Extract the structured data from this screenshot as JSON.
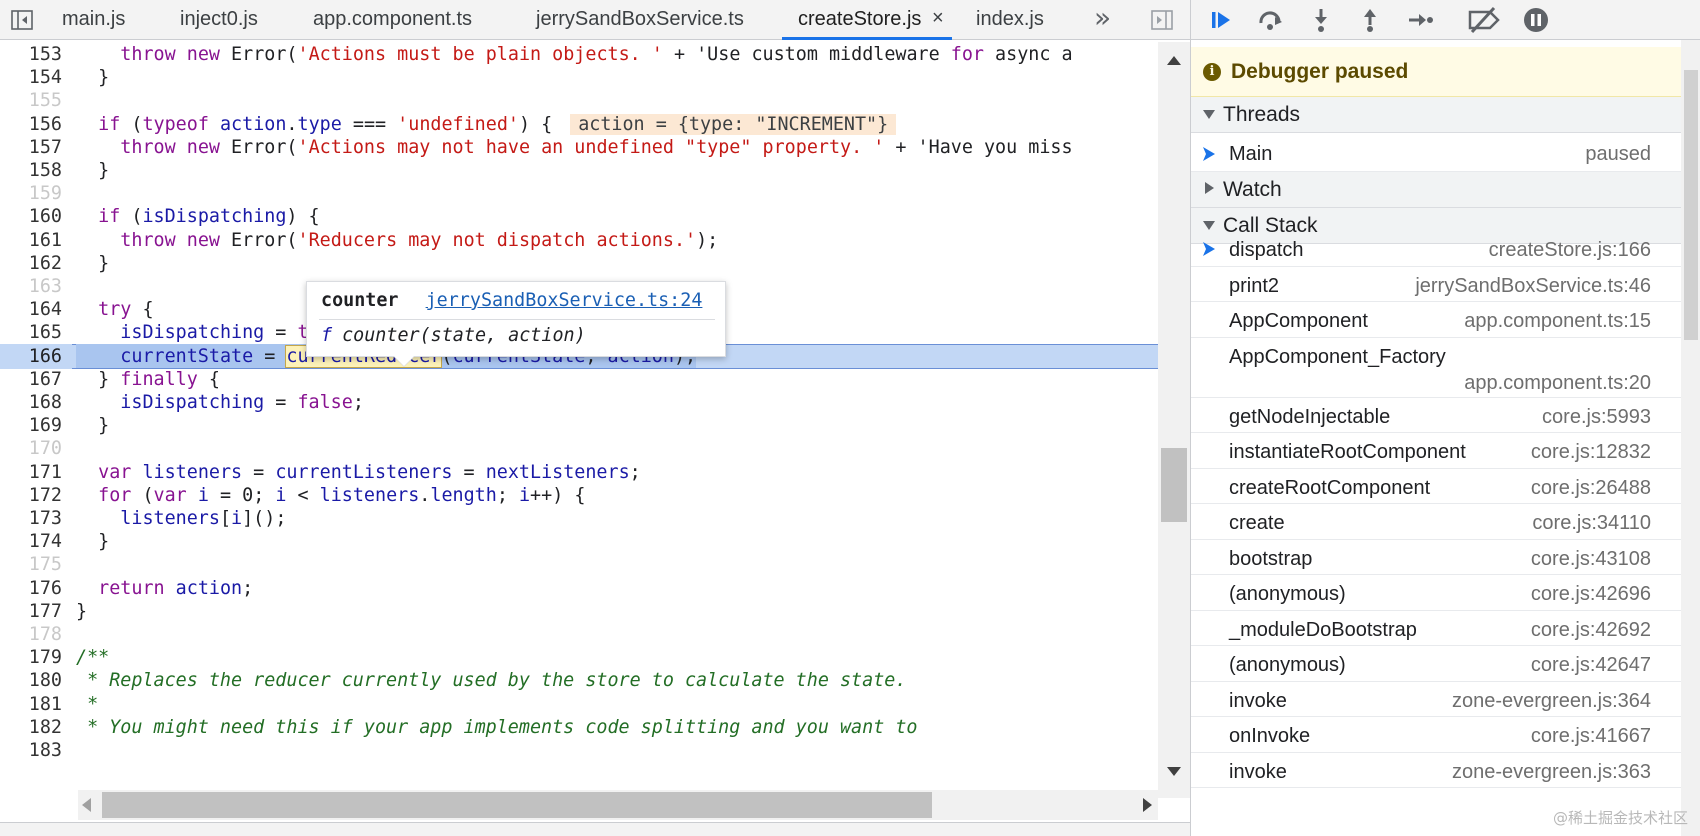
{
  "tabs": [
    {
      "label": "main.js"
    },
    {
      "label": "inject0.js"
    },
    {
      "label": "app.component.ts"
    },
    {
      "label": "jerrySandBoxService.ts"
    },
    {
      "label": "createStore.js",
      "active": true,
      "close": "×"
    },
    {
      "label": "index.js"
    }
  ],
  "tabs_more": "»",
  "code_lines": [
    {
      "n": "153",
      "text": "    throw new Error('Actions must be plain objects. ' + 'Use custom middleware for async a"
    },
    {
      "n": "154",
      "text": "  }"
    },
    {
      "n": "155",
      "text": ""
    },
    {
      "n": "156",
      "text": "  if (typeof action.type === 'undefined') {"
    },
    {
      "n": "157",
      "text": "    throw new Error('Actions may not have an undefined \"type\" property. ' + 'Have you miss"
    },
    {
      "n": "158",
      "text": "  }"
    },
    {
      "n": "159",
      "text": ""
    },
    {
      "n": "160",
      "text": "  if (isDispatching) {"
    },
    {
      "n": "161",
      "text": "    throw new Error('Reducers may not dispatch actions.');"
    },
    {
      "n": "162",
      "text": "  }"
    },
    {
      "n": "163",
      "text": ""
    },
    {
      "n": "164",
      "text": "  try {"
    },
    {
      "n": "165",
      "text": "    isDispatching = true;"
    },
    {
      "n": "166",
      "text": "    currentState = currentReducer(currentState, action);"
    },
    {
      "n": "167",
      "text": "  } finally {"
    },
    {
      "n": "168",
      "text": "    isDispatching = false;"
    },
    {
      "n": "169",
      "text": "  }"
    },
    {
      "n": "170",
      "text": ""
    },
    {
      "n": "171",
      "text": "  var listeners = currentListeners = nextListeners;"
    },
    {
      "n": "172",
      "text": "  for (var i = 0; i < listeners.length; i++) {"
    },
    {
      "n": "173",
      "text": "    listeners[i]();"
    },
    {
      "n": "174",
      "text": "  }"
    },
    {
      "n": "175",
      "text": ""
    },
    {
      "n": "176",
      "text": "  return action;"
    },
    {
      "n": "177",
      "text": "}"
    },
    {
      "n": "178",
      "text": ""
    },
    {
      "n": "179",
      "text": "/**"
    },
    {
      "n": "180",
      "text": " * Replaces the reducer currently used by the store to calculate the state."
    },
    {
      "n": "181",
      "text": " *"
    },
    {
      "n": "182",
      "text": " * You might need this if your app implements code splitting and you want to"
    },
    {
      "n": "183",
      "text": ""
    }
  ],
  "inline_value": "action = {type: \"INCREMENT\"}",
  "popover": {
    "title": "counter",
    "link": "jerrySandBoxService.ts:24",
    "fn_symbol": "f",
    "signature": "counter(state, action)"
  },
  "debugger": {
    "banner": "Debugger paused",
    "banner_icon": "i",
    "threads_header": "Threads",
    "thread": {
      "name": "Main",
      "status": "paused"
    },
    "watch_header": "Watch",
    "callstack_header": "Call Stack",
    "frames": [
      {
        "name": "dispatch",
        "loc": "createStore.js:166",
        "current": true
      },
      {
        "name": "print2",
        "loc": "jerrySandBoxService.ts:46"
      },
      {
        "name": "AppComponent",
        "loc": "app.component.ts:15"
      },
      {
        "name": "AppComponent_Factory",
        "loc": "app.component.ts:20",
        "tall": true
      },
      {
        "name": "getNodeInjectable",
        "loc": "core.js:5993"
      },
      {
        "name": "instantiateRootComponent",
        "loc": "core.js:12832"
      },
      {
        "name": "createRootComponent",
        "loc": "core.js:26488"
      },
      {
        "name": "create",
        "loc": "core.js:34110"
      },
      {
        "name": "bootstrap",
        "loc": "core.js:43108"
      },
      {
        "name": "(anonymous)",
        "loc": "core.js:42696"
      },
      {
        "name": "_moduleDoBootstrap",
        "loc": "core.js:42692"
      },
      {
        "name": "(anonymous)",
        "loc": "core.js:42647"
      },
      {
        "name": "invoke",
        "loc": "zone-evergreen.js:364"
      },
      {
        "name": "onInvoke",
        "loc": "core.js:41667"
      },
      {
        "name": "invoke",
        "loc": "zone-evergreen.js:363"
      }
    ]
  },
  "watermark": "@稀土掘金技术社区",
  "colors": {
    "accent": "#1a73e8",
    "current_line": "#c2d7f5",
    "banner_bg": "#fffbe5",
    "keyword": "#881391",
    "string": "#c41a16",
    "comment": "#236e25"
  }
}
